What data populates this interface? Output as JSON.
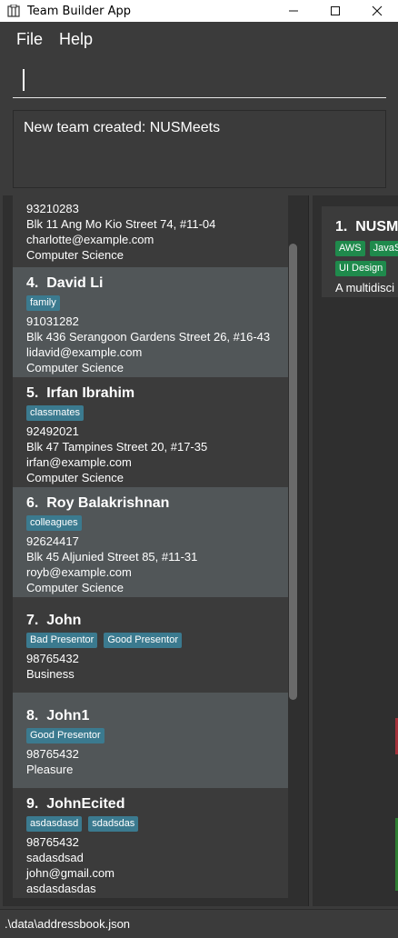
{
  "window": {
    "title": "Team Builder App",
    "minimize": "—",
    "maximize": "☐",
    "close": "✕"
  },
  "menu": {
    "file": "File",
    "help": "Help"
  },
  "command": {
    "value": ""
  },
  "result": {
    "text": "New team created: NUSMeets"
  },
  "persons": [
    {
      "index": "",
      "name": "",
      "tags": [],
      "phone": "93210283",
      "address": "Blk 11 Ang Mo Kio Street 74, #11-04",
      "email": "charlotte@example.com",
      "major": "Computer Science"
    },
    {
      "index": "4.",
      "name": "David Li",
      "tags": [
        "family"
      ],
      "phone": "91031282",
      "address": "Blk 436 Serangoon Gardens Street 26, #16-43",
      "email": "lidavid@example.com",
      "major": "Computer Science"
    },
    {
      "index": "5.",
      "name": "Irfan Ibrahim",
      "tags": [
        "classmates"
      ],
      "phone": "92492021",
      "address": "Blk 47 Tampines Street 20, #17-35",
      "email": "irfan@example.com",
      "major": "Computer Science"
    },
    {
      "index": "6.",
      "name": "Roy Balakrishnan",
      "tags": [
        "colleagues"
      ],
      "phone": "92624417",
      "address": "Blk 45 Aljunied Street 85, #11-31",
      "email": "royb@example.com",
      "major": "Computer Science"
    },
    {
      "index": "7.",
      "name": "John",
      "tags": [
        "Bad Presentor",
        "Good Presentor"
      ],
      "phone": "98765432",
      "major": "Business"
    },
    {
      "index": "8.",
      "name": "John1",
      "tags": [
        "Good Presentor"
      ],
      "phone": "98765432",
      "major": "Pleasure"
    },
    {
      "index": "9.",
      "name": "JohnEcited",
      "tags": [
        "asdasdasd",
        "sdadsdas"
      ],
      "phone": "98765432",
      "address": "sadasdsad",
      "email": "john@gmail.com",
      "major": "asdasdasdas"
    }
  ],
  "team": {
    "index": "1.",
    "name": "NUSM",
    "tags": [
      "AWS",
      "JavaS",
      "UI Design"
    ],
    "description": "A multidisci"
  },
  "status": {
    "path": ".\\data\\addressbook.json"
  },
  "colors": {
    "tag": "#3b7a8f",
    "team_tag": "#1f8a4c",
    "card_light": "#515658",
    "card_dark": "#3b3b3b"
  }
}
